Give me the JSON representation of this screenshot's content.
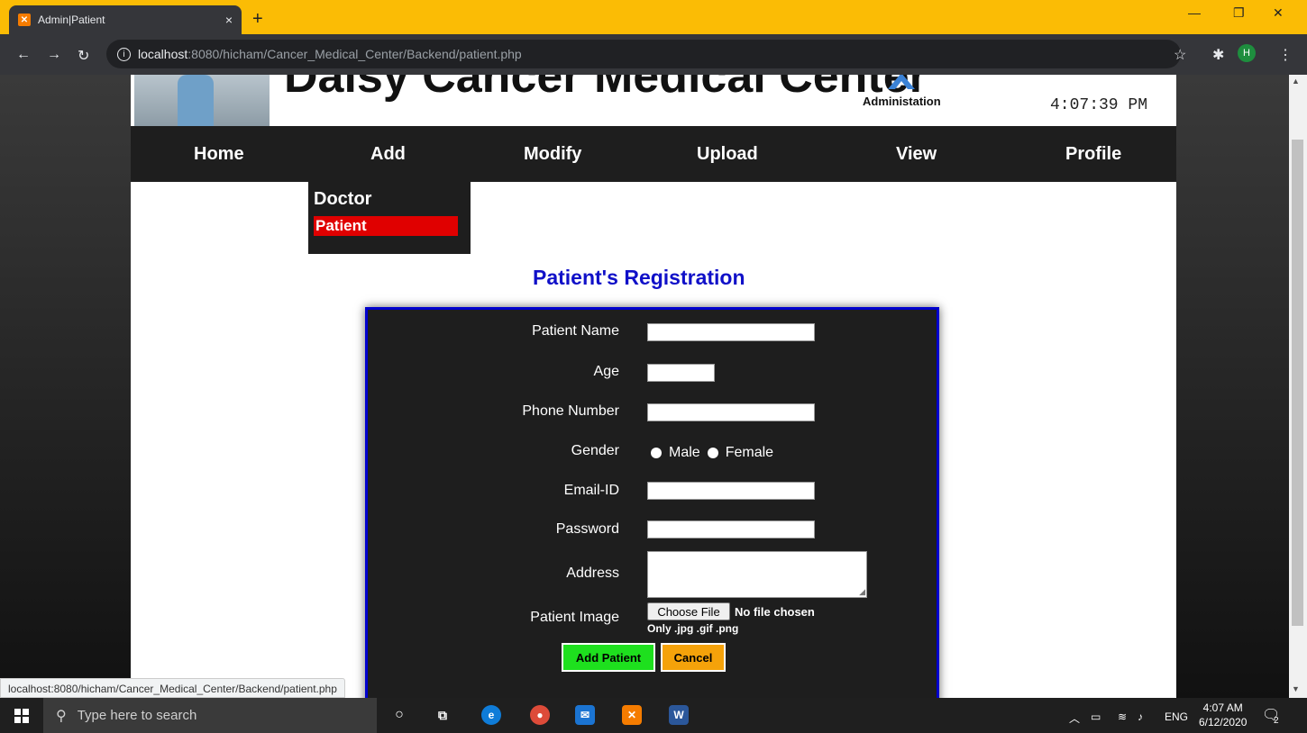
{
  "browser": {
    "tab_title": "Admin|Patient",
    "tab_close": "×",
    "new_tab": "+",
    "url_host": "localhost",
    "url_rest": ":8080/hicham/Cancer_Medical_Center/Backend/patient.php",
    "status_url": "localhost:8080/hicham/Cancer_Medical_Center/Backend/patient.php",
    "profile_initial": "H",
    "theme_color": "#fbbc05"
  },
  "header": {
    "site_title": "Daisy Cancer Medical Center",
    "admin_label": "Administation",
    "clock": "4:07:39 PM"
  },
  "nav": {
    "items": [
      "Home",
      "Add",
      "Modify",
      "Upload",
      "View",
      "Profile"
    ]
  },
  "dropdown": {
    "doctor": "Doctor",
    "patient": "Patient"
  },
  "form": {
    "title": "Patient's Registration",
    "labels": {
      "name": "Patient Name",
      "age": "Age",
      "phone": "Phone Number",
      "gender": "Gender",
      "email": "Email-ID",
      "password": "Password",
      "address": "Address",
      "image": "Patient Image"
    },
    "gender_options": [
      "Male",
      "Female"
    ],
    "file_button": "Choose File",
    "file_status": "No file chosen",
    "file_hint": "Only .jpg .gif .png",
    "submit": "Add Patient",
    "cancel": "Cancel",
    "submit_color": "#1ee01e",
    "cancel_color": "#f5a20a"
  },
  "taskbar": {
    "search_placeholder": "Type here to search",
    "lang": "ENG",
    "time": "4:07 AM",
    "date": "6/12/2020",
    "notifications": "2"
  }
}
